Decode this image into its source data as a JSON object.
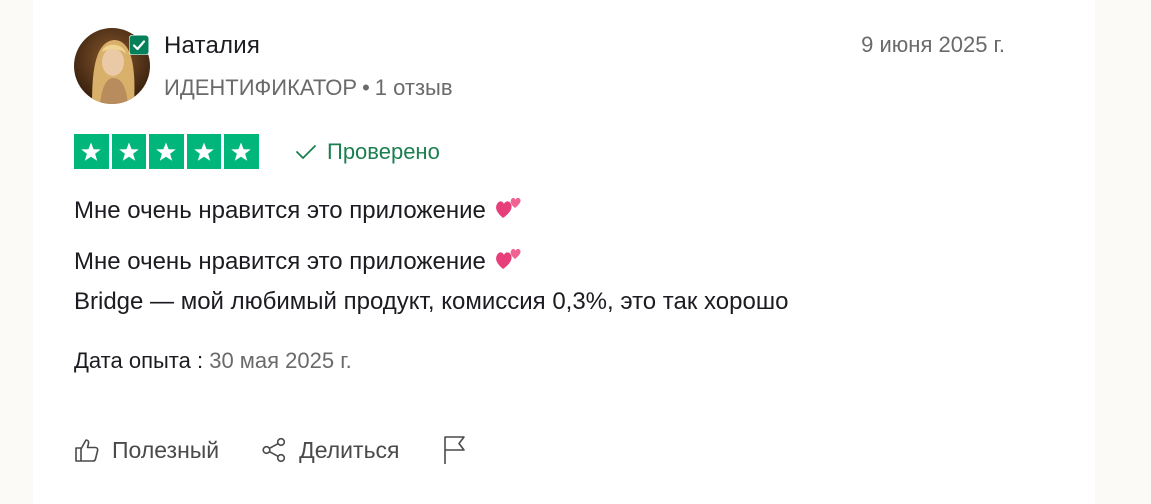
{
  "reviewer": {
    "name": "Наталия",
    "country_code": "ИДЕНТИФИКАТОР",
    "separator": "•",
    "reviews_count": "1 отзыв"
  },
  "review": {
    "date": "9 июня 2025 г.",
    "rating": 5,
    "rating_max": 5,
    "verified_label": "Проверено",
    "title": "Мне очень нравится это приложение",
    "body_line1": "Мне очень нравится это приложение",
    "body_line2": "Bridge — мой любимый продукт, комиссия 0,3%, это так хорошо",
    "experience_label": "Дата опыта :",
    "experience_date": "30 мая 2025 г."
  },
  "actions": {
    "useful_label": "Полезный",
    "share_label": "Делиться"
  },
  "colors": {
    "star_green": "#00b67a",
    "verified_green": "#1b7f4f",
    "badge_green": "#04805a",
    "muted_text": "#6a6a6a"
  },
  "icons": [
    "verified-check-icon",
    "star-icon",
    "check-icon",
    "two-hearts-emoji",
    "thumbs-up-icon",
    "share-icon",
    "flag-icon"
  ]
}
